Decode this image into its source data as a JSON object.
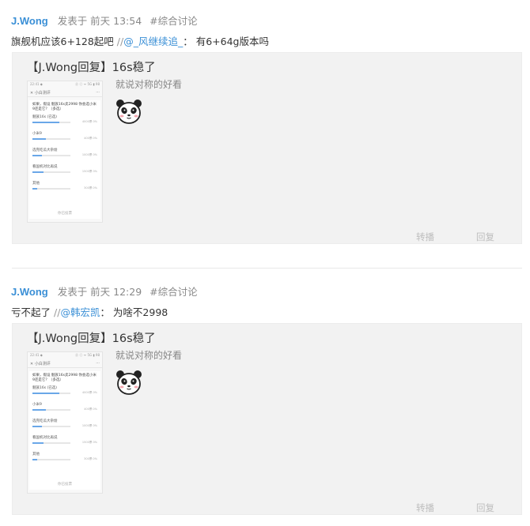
{
  "posts": [
    {
      "author": "J.Wong",
      "published": "发表于 前天 13:54",
      "tag": "#综合讨论",
      "reply_text": "旗舰机应该6+128起吧",
      "separator": "//",
      "mention": "@_风继续追_",
      "mention_suffix": "： 有6+64g版本吗",
      "quote": {
        "title": "【J.Wong回复】16s稳了",
        "subtitle": "就说对称的好看",
        "share_label": "转播",
        "reply_label": "回复"
      }
    },
    {
      "author": "J.Wong",
      "published": "发表于 前天 12:29",
      "tag": "#综合讨论",
      "reply_text": "亏不起了",
      "separator": "//",
      "mention": "@韩宏凯",
      "mention_suffix": "： 为啥不2998",
      "quote": {
        "title": "【J.Wong回复】16s稳了",
        "subtitle": "就说对称的好看",
        "share_label": "转播",
        "reply_label": "回复"
      }
    }
  ],
  "thumbnail": {
    "status_left": "22:41 ◆",
    "status_right": "ⓖ ⓒ ᯤ 5G ▮ 98",
    "nav_title": "小白测评",
    "nav_close": "✕",
    "nav_more": "···",
    "question": "如果，假设 魅族16s卖2998 你会选小米9还是它？（多选）",
    "options": [
      {
        "label": "魅族16s (已选)",
        "stat": "4000票 0%",
        "fill": 0.7
      },
      {
        "label": "小米9",
        "stat": "400票 0%",
        "fill": 0.35
      },
      {
        "label": "选完吃瓜大杂烩",
        "stat": "1000票 0%",
        "fill": 0.25
      },
      {
        "label": "看国机对比再说",
        "stat": "1500票 0%",
        "fill": 0.3
      },
      {
        "label": "其他",
        "stat": "300票 0%",
        "fill": 0.12
      }
    ],
    "footer": "你已投票"
  },
  "colors": {
    "author": "#3a8fd6",
    "mention": "#3a8fd6",
    "quote_bg": "#f2f2f2",
    "bar_fill": "#6aa7e8"
  },
  "icons": {
    "avatar": "panda-face-emoji"
  }
}
